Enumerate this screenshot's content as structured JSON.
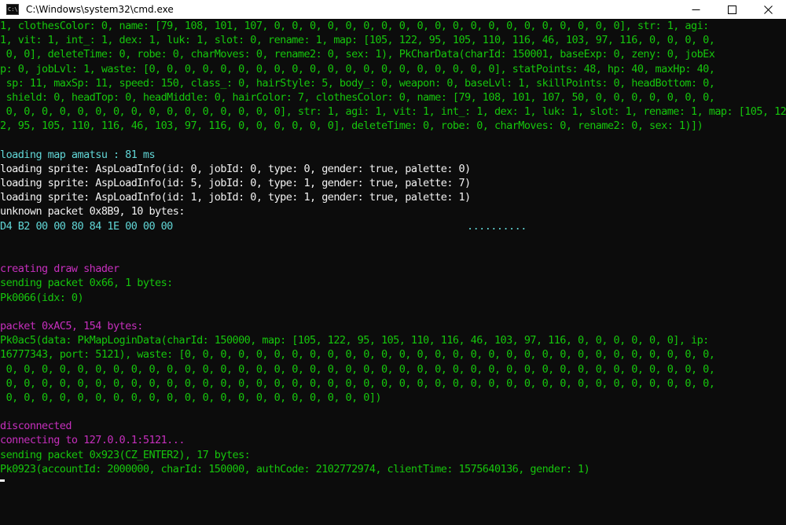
{
  "window": {
    "title": "C:\\Windows\\system32\\cmd.exe",
    "icon_text": "C:\\."
  },
  "console": {
    "lines": [
      {
        "color": "green",
        "text": "1, clothesColor: 0, name: [79, 108, 101, 107, 0, 0, 0, 0, 0, 0, 0, 0, 0, 0, 0, 0, 0, 0, 0, 0, 0, 0, 0, 0], str: 1, agi:"
      },
      {
        "color": "green",
        "text": "1, vit: 1, int_: 1, dex: 1, luk: 1, slot: 0, rename: 1, map: [105, 122, 95, 105, 110, 116, 46, 103, 97, 116, 0, 0, 0, 0,"
      },
      {
        "color": "green",
        "text": " 0, 0], deleteTime: 0, robe: 0, charMoves: 0, rename2: 0, sex: 1), PkCharData(charId: 150001, baseExp: 0, zeny: 0, jobEx"
      },
      {
        "color": "green",
        "text": "p: 0, jobLvl: 1, waste: [0, 0, 0, 0, 0, 0, 0, 0, 0, 0, 0, 0, 0, 0, 0, 0, 0, 0, 0, 0], statPoints: 48, hp: 40, maxHp: 40,"
      },
      {
        "color": "green",
        "text": " sp: 11, maxSp: 11, speed: 150, class_: 0, hairStyle: 5, body_: 0, weapon: 0, baseLvl: 1, skillPoints: 0, headBottom: 0,"
      },
      {
        "color": "green",
        "text": " shield: 0, headTop: 0, headMiddle: 0, hairColor: 7, clothesColor: 0, name: [79, 108, 101, 107, 50, 0, 0, 0, 0, 0, 0, 0,"
      },
      {
        "color": "green",
        "text": " 0, 0, 0, 0, 0, 0, 0, 0, 0, 0, 0, 0, 0, 0, 0, 0], str: 1, agi: 1, vit: 1, int_: 1, dex: 1, luk: 1, slot: 1, rename: 1, map: [105, 12"
      },
      {
        "color": "green",
        "text": "2, 95, 105, 110, 116, 46, 103, 97, 116, 0, 0, 0, 0, 0, 0], deleteTime: 0, robe: 0, charMoves: 0, rename2: 0, sex: 1)])"
      },
      {
        "color": "green",
        "text": ""
      },
      {
        "color": "cyan",
        "text": "loading map amatsu : 81 ms"
      },
      {
        "color": "white",
        "text": "loading sprite: AspLoadInfo(id: 0, jobId: 0, type: 0, gender: true, palette: 0)"
      },
      {
        "color": "white",
        "text": "loading sprite: AspLoadInfo(id: 5, jobId: 0, type: 1, gender: true, palette: 7)"
      },
      {
        "color": "white",
        "text": "loading sprite: AspLoadInfo(id: 1, jobId: 0, type: 1, gender: true, palette: 1)"
      },
      {
        "color": "white",
        "text": "unknown packet 0x8B9, 10 bytes:"
      },
      {
        "color": "cyan",
        "text": "D4 B2 00 00 80 84 1E 00 00 00",
        "ascii": ".........."
      },
      {
        "color": "green",
        "text": ""
      },
      {
        "color": "green",
        "text": ""
      },
      {
        "color": "magenta",
        "text": "creating draw shader"
      },
      {
        "color": "green",
        "text": "sending packet 0x66, 1 bytes:"
      },
      {
        "color": "green",
        "text": "Pk0066(idx: 0)"
      },
      {
        "color": "green",
        "text": ""
      },
      {
        "color": "magenta",
        "text": "packet 0xAC5, 154 bytes:"
      },
      {
        "color": "green",
        "text": "Pk0ac5(data: PkMapLoginData(charId: 150000, map: [105, 122, 95, 105, 110, 116, 46, 103, 97, 116, 0, 0, 0, 0, 0, 0], ip:"
      },
      {
        "color": "green",
        "text": "16777343, port: 5121), waste: [0, 0, 0, 0, 0, 0, 0, 0, 0, 0, 0, 0, 0, 0, 0, 0, 0, 0, 0, 0, 0, 0, 0, 0, 0, 0, 0, 0, 0, 0,"
      },
      {
        "color": "green",
        "text": " 0, 0, 0, 0, 0, 0, 0, 0, 0, 0, 0, 0, 0, 0, 0, 0, 0, 0, 0, 0, 0, 0, 0, 0, 0, 0, 0, 0, 0, 0, 0, 0, 0, 0, 0, 0, 0, 0, 0, 0,"
      },
      {
        "color": "green",
        "text": " 0, 0, 0, 0, 0, 0, 0, 0, 0, 0, 0, 0, 0, 0, 0, 0, 0, 0, 0, 0, 0, 0, 0, 0, 0, 0, 0, 0, 0, 0, 0, 0, 0, 0, 0, 0, 0, 0, 0, 0,"
      },
      {
        "color": "green",
        "text": " 0, 0, 0, 0, 0, 0, 0, 0, 0, 0, 0, 0, 0, 0, 0, 0, 0, 0, 0, 0, 0])"
      },
      {
        "color": "green",
        "text": ""
      },
      {
        "color": "magenta",
        "text": "disconnected"
      },
      {
        "color": "magenta",
        "text": "connecting to 127.0.0.1:5121..."
      },
      {
        "color": "green",
        "text": "sending packet 0x923(CZ_ENTER2), 17 bytes:"
      },
      {
        "color": "green",
        "text": "Pk0923(accountId: 2000000, charId: 150000, authCode: 2102772974, clientTime: 1575640136, gender: 1)"
      }
    ]
  },
  "colors": {
    "background": "#0c0c0c",
    "green": "#16c60c",
    "cyan": "#61d6d6",
    "white": "#f2f2f2",
    "magenta": "#c62fbd",
    "titlebar": "#ffffff"
  },
  "icons": {
    "app": "console-icon",
    "minimize": "minimize-icon",
    "maximize": "maximize-icon",
    "close": "close-icon"
  }
}
